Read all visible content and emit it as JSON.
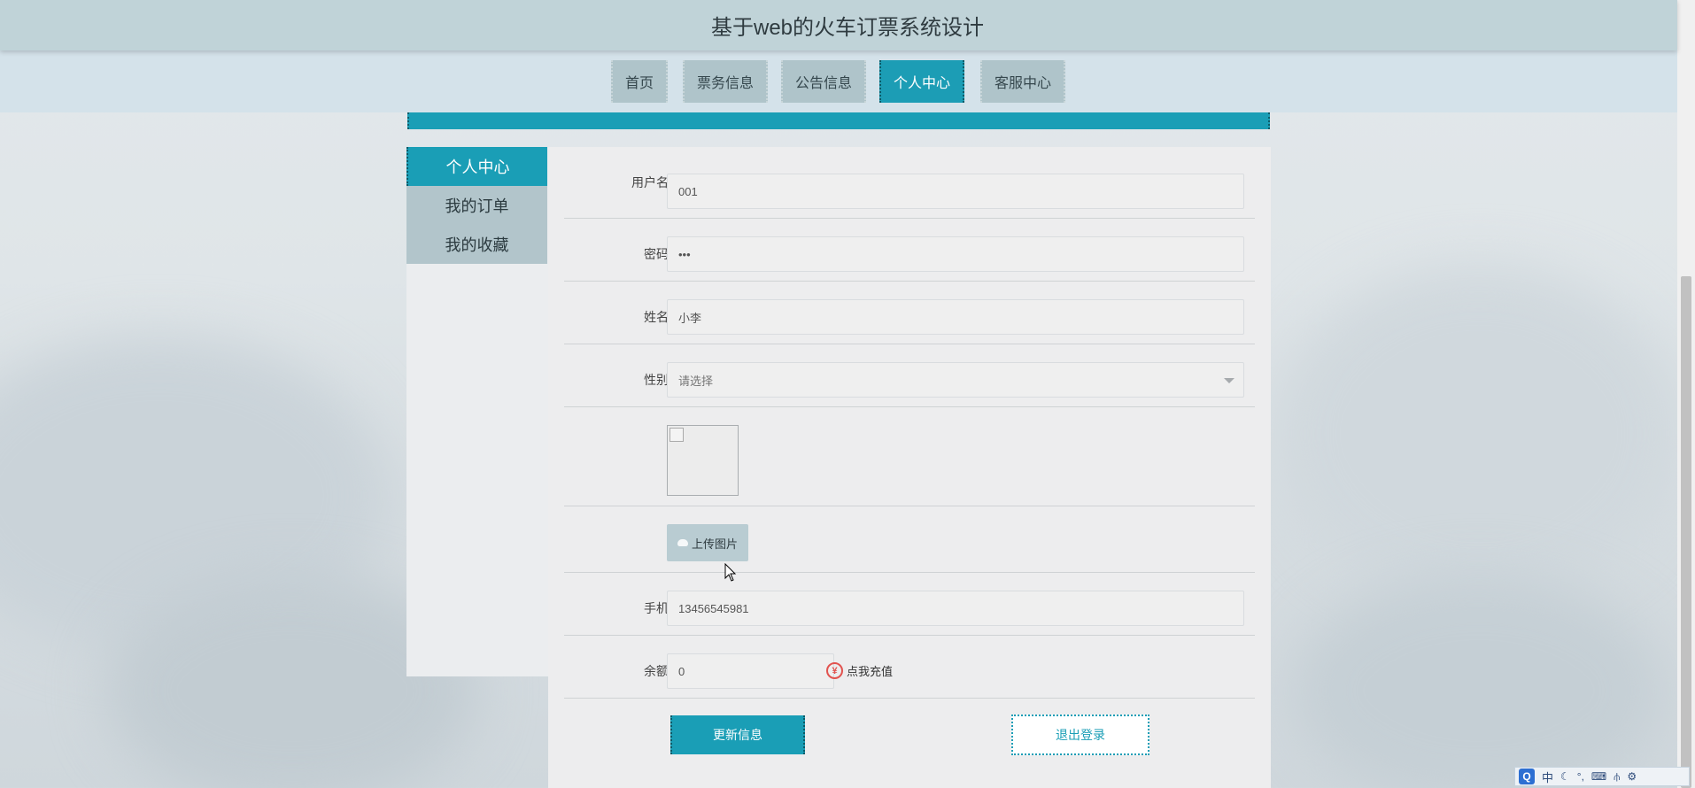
{
  "header": {
    "title": "基于web的火车订票系统设计"
  },
  "nav": {
    "items": [
      {
        "label": "首页"
      },
      {
        "label": "票务信息"
      },
      {
        "label": "公告信息"
      },
      {
        "label": "个人中心"
      },
      {
        "label": "客服中心"
      }
    ],
    "active": "个人中心"
  },
  "sidebar": {
    "items": [
      {
        "label": "个人中心"
      },
      {
        "label": "我的订单"
      },
      {
        "label": "我的收藏"
      }
    ]
  },
  "form": {
    "username": {
      "label": "用户名",
      "value": "001"
    },
    "password": {
      "label": "密码",
      "value": "•••"
    },
    "name": {
      "label": "姓名",
      "value": "小李"
    },
    "gender": {
      "label": "性别",
      "placeholder": "请选择"
    },
    "upload": {
      "label": "上传图片"
    },
    "phone": {
      "label": "手机",
      "value": "13456545981"
    },
    "balance": {
      "label": "余额",
      "value": "0",
      "recharge_label": "点我充值",
      "currency_symbol": "¥"
    }
  },
  "buttons": {
    "update": "更新信息",
    "logout": "退出登录"
  },
  "ime": {
    "logo": "Q",
    "mode": "中",
    "punct": "°,",
    "tool": "⚙"
  },
  "colors": {
    "accent": "#1a9eb6",
    "nav_inactive": "#afc4ca",
    "header_bg": "#c0d3d8"
  }
}
